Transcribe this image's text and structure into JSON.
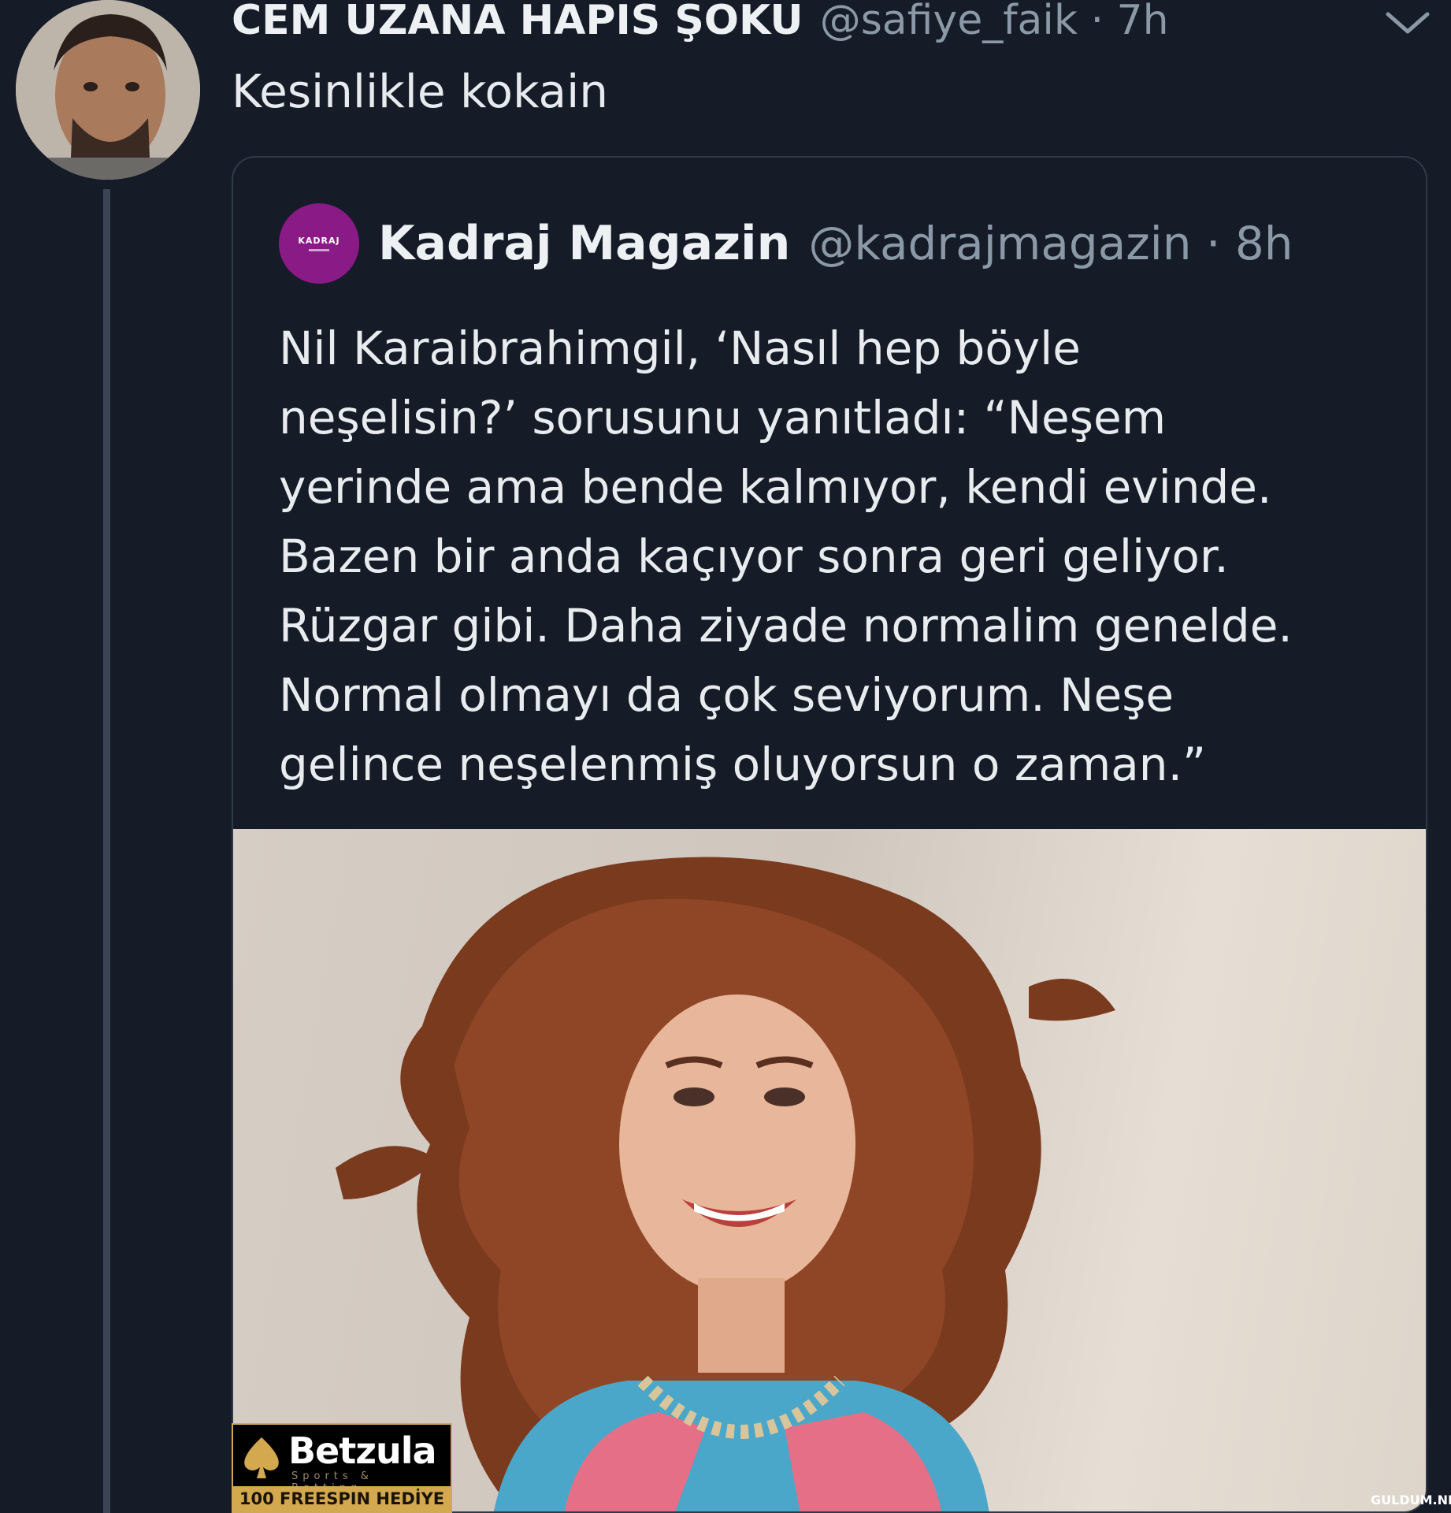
{
  "tweet": {
    "display_name": "CEM UZANA HAPIS ŞOKU",
    "handle_time": "@safiye_faik · 7h",
    "text": "Kesinlikle kokain",
    "avatar_icon": "user-avatar-photo",
    "menu_icon": "chevron-down-icon"
  },
  "quoted": {
    "logo_text": "KADRAJ",
    "display_name": "Kadraj Magazin",
    "handle_time": "@kadrajmagazin · 8h",
    "lines": [
      "Nil Karaibrahimgil, ‘Nasıl hep böyle",
      "neşelisin?’ sorusunu yanıtladı: “Neşem",
      "yerinde ama bende kalmıyor, kendi evinde.",
      "Bazen bir anda kaçıyor sonra geri geliyor.",
      "Rüzgar gibi. Daha ziyade normalim genelde.",
      "Normal olmayı da çok seviyorum. Neşe",
      "gelince neşelenmiş oluyorsun o zaman.”"
    ],
    "photo_icon": "portrait-photo"
  },
  "ad": {
    "brand": "Betzula",
    "tagline": "Sports & Betting",
    "cta": "100 FREESPIN HEDİYE",
    "icon": "spade-icon",
    "accent": "#d3a84e"
  },
  "watermark": "GULDUM.NET",
  "colors": {
    "background": "#151c28",
    "text": "#e9ecef",
    "muted": "#8b98a5",
    "border": "#2f3a48",
    "logo": "#8a1a86"
  }
}
